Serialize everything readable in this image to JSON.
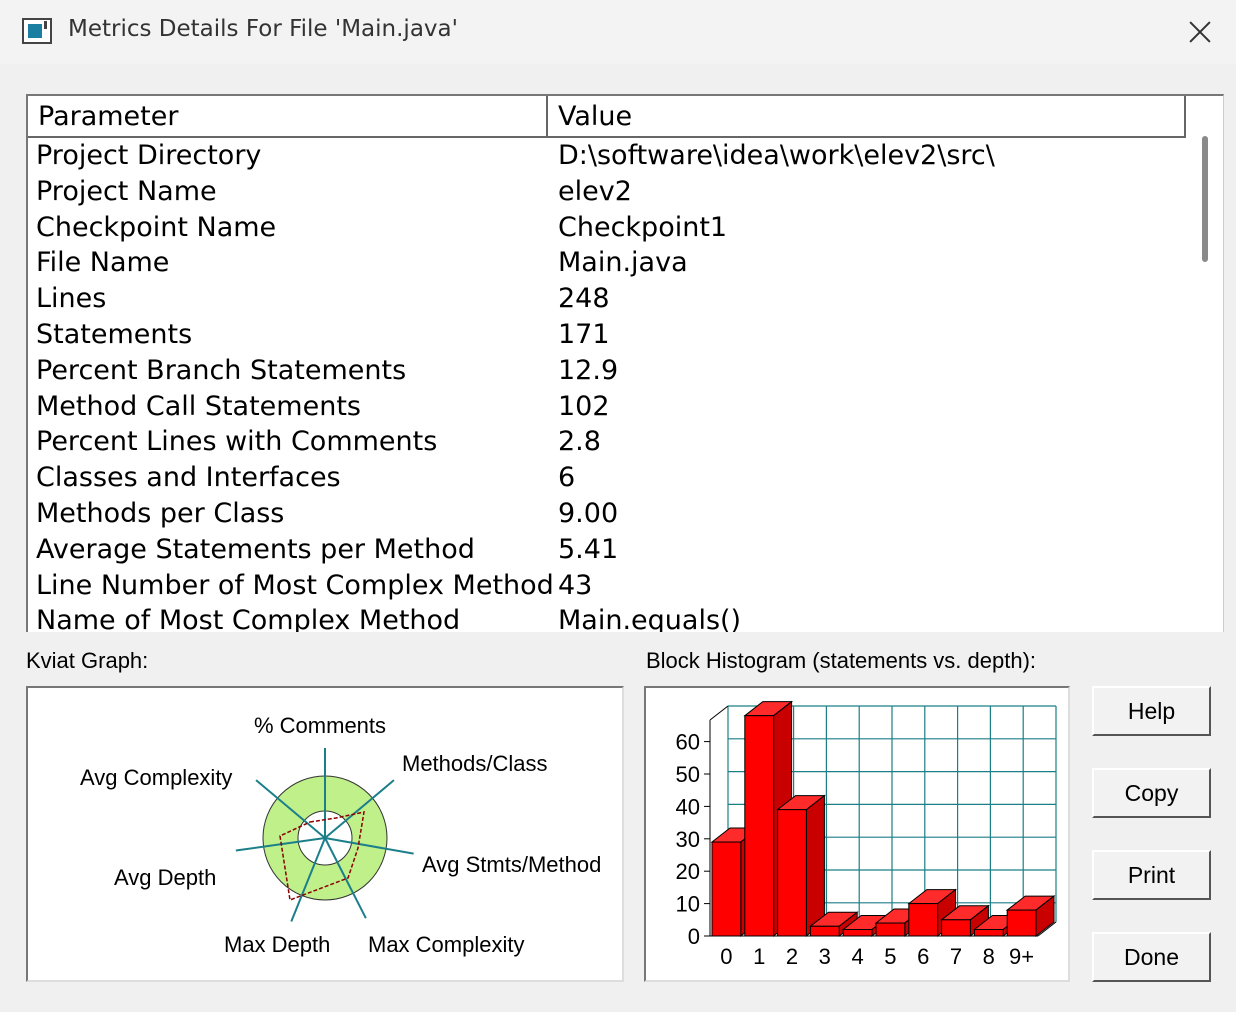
{
  "window": {
    "title": "Metrics Details For File 'Main.java'"
  },
  "table": {
    "headers": [
      "Parameter",
      "Value"
    ],
    "rows": [
      {
        "param": "Project Directory",
        "value": "D:\\software\\idea\\work\\elev2\\src\\"
      },
      {
        "param": "Project Name",
        "value": "elev2"
      },
      {
        "param": "Checkpoint Name",
        "value": "Checkpoint1"
      },
      {
        "param": "File Name",
        "value": "Main.java"
      },
      {
        "param": "Lines",
        "value": "248"
      },
      {
        "param": "Statements",
        "value": "171"
      },
      {
        "param": "Percent Branch Statements",
        "value": "12.9"
      },
      {
        "param": "Method Call Statements",
        "value": "102"
      },
      {
        "param": "Percent Lines with Comments",
        "value": "2.8"
      },
      {
        "param": "Classes and Interfaces",
        "value": "6"
      },
      {
        "param": "Methods per Class",
        "value": "9.00"
      },
      {
        "param": "Average Statements per Method",
        "value": "5.41"
      },
      {
        "param": "Line Number of Most Complex Method",
        "value": "43"
      },
      {
        "param": "Name of Most Complex Method",
        "value": "Main.equals()"
      }
    ]
  },
  "kviat": {
    "label": "Kviat Graph:",
    "axes": [
      "% Comments",
      "Methods/Class",
      "Avg Stmts/Method",
      "Max Complexity",
      "Max Depth",
      "Avg Depth",
      "Avg Complexity"
    ]
  },
  "histogram": {
    "label": "Block Histogram (statements vs. depth):"
  },
  "chart_data": {
    "type": "bar",
    "categories": [
      "0",
      "1",
      "2",
      "3",
      "4",
      "5",
      "6",
      "7",
      "8",
      "9+"
    ],
    "values": [
      29,
      68,
      39,
      3,
      2,
      4,
      10,
      5,
      2,
      8
    ],
    "yticks": [
      0,
      10,
      20,
      30,
      40,
      50,
      60
    ],
    "ylim": [
      0,
      70
    ],
    "color": "#ff0000"
  },
  "buttons": {
    "help": "Help",
    "copy": "Copy",
    "print": "Print",
    "done": "Done"
  }
}
